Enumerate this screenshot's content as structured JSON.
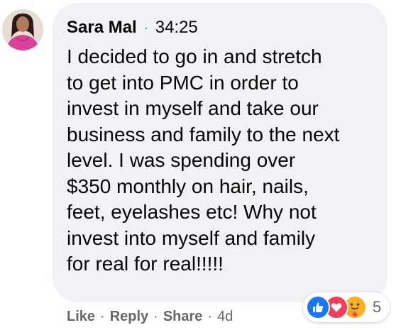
{
  "comment": {
    "author": "Sara Mal",
    "separator": "·",
    "timestamp": "34:25",
    "text": "I decided to go in and stretch\nto get into PMC in order to\ninvest in myself and take our\nbusiness and family to the next\nlevel. I was spending over\n$350 monthly on hair, nails,\nfeet, eyelashes etc! Why not\ninvest into myself and family\nfor real for real!!!!!"
  },
  "actions": {
    "like": "Like",
    "reply": "Reply",
    "share": "Share",
    "separator": "·",
    "age": "4d"
  },
  "reactions": {
    "icons": [
      "like-icon",
      "love-icon",
      "care-icon"
    ],
    "count": "5"
  },
  "colors": {
    "bubble": "#f0f2f5",
    "text": "#050505",
    "secondary_text": "#65676b",
    "accent_blue": "#1877f2",
    "love_red": "#f33e58",
    "care_yellow": "#f7b125"
  }
}
